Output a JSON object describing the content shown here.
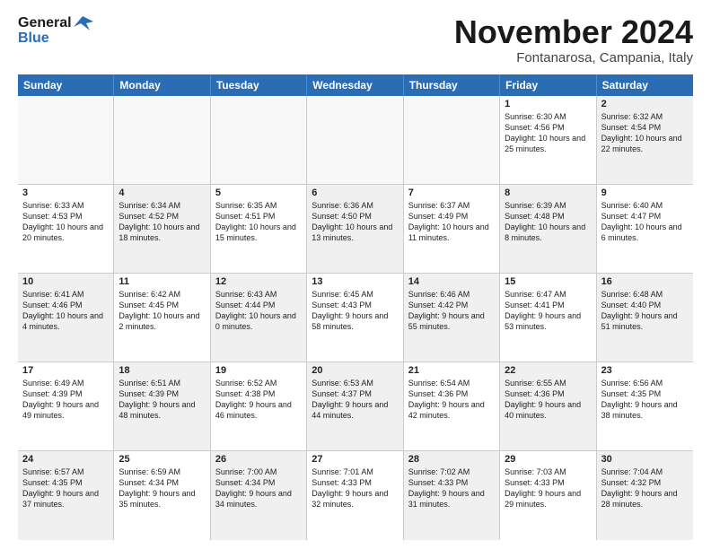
{
  "logo": {
    "line1": "General",
    "line2": "Blue"
  },
  "title": "November 2024",
  "location": "Fontanarosa, Campania, Italy",
  "header_days": [
    "Sunday",
    "Monday",
    "Tuesday",
    "Wednesday",
    "Thursday",
    "Friday",
    "Saturday"
  ],
  "weeks": [
    [
      {
        "day": "",
        "info": "",
        "shaded": true
      },
      {
        "day": "",
        "info": "",
        "shaded": true
      },
      {
        "day": "",
        "info": "",
        "shaded": true
      },
      {
        "day": "",
        "info": "",
        "shaded": true
      },
      {
        "day": "",
        "info": "",
        "shaded": true
      },
      {
        "day": "1",
        "info": "Sunrise: 6:30 AM\nSunset: 4:56 PM\nDaylight: 10 hours and 25 minutes.",
        "shaded": false
      },
      {
        "day": "2",
        "info": "Sunrise: 6:32 AM\nSunset: 4:54 PM\nDaylight: 10 hours and 22 minutes.",
        "shaded": true
      }
    ],
    [
      {
        "day": "3",
        "info": "Sunrise: 6:33 AM\nSunset: 4:53 PM\nDaylight: 10 hours and 20 minutes.",
        "shaded": false
      },
      {
        "day": "4",
        "info": "Sunrise: 6:34 AM\nSunset: 4:52 PM\nDaylight: 10 hours and 18 minutes.",
        "shaded": true
      },
      {
        "day": "5",
        "info": "Sunrise: 6:35 AM\nSunset: 4:51 PM\nDaylight: 10 hours and 15 minutes.",
        "shaded": false
      },
      {
        "day": "6",
        "info": "Sunrise: 6:36 AM\nSunset: 4:50 PM\nDaylight: 10 hours and 13 minutes.",
        "shaded": true
      },
      {
        "day": "7",
        "info": "Sunrise: 6:37 AM\nSunset: 4:49 PM\nDaylight: 10 hours and 11 minutes.",
        "shaded": false
      },
      {
        "day": "8",
        "info": "Sunrise: 6:39 AM\nSunset: 4:48 PM\nDaylight: 10 hours and 8 minutes.",
        "shaded": true
      },
      {
        "day": "9",
        "info": "Sunrise: 6:40 AM\nSunset: 4:47 PM\nDaylight: 10 hours and 6 minutes.",
        "shaded": false
      }
    ],
    [
      {
        "day": "10",
        "info": "Sunrise: 6:41 AM\nSunset: 4:46 PM\nDaylight: 10 hours and 4 minutes.",
        "shaded": true
      },
      {
        "day": "11",
        "info": "Sunrise: 6:42 AM\nSunset: 4:45 PM\nDaylight: 10 hours and 2 minutes.",
        "shaded": false
      },
      {
        "day": "12",
        "info": "Sunrise: 6:43 AM\nSunset: 4:44 PM\nDaylight: 10 hours and 0 minutes.",
        "shaded": true
      },
      {
        "day": "13",
        "info": "Sunrise: 6:45 AM\nSunset: 4:43 PM\nDaylight: 9 hours and 58 minutes.",
        "shaded": false
      },
      {
        "day": "14",
        "info": "Sunrise: 6:46 AM\nSunset: 4:42 PM\nDaylight: 9 hours and 55 minutes.",
        "shaded": true
      },
      {
        "day": "15",
        "info": "Sunrise: 6:47 AM\nSunset: 4:41 PM\nDaylight: 9 hours and 53 minutes.",
        "shaded": false
      },
      {
        "day": "16",
        "info": "Sunrise: 6:48 AM\nSunset: 4:40 PM\nDaylight: 9 hours and 51 minutes.",
        "shaded": true
      }
    ],
    [
      {
        "day": "17",
        "info": "Sunrise: 6:49 AM\nSunset: 4:39 PM\nDaylight: 9 hours and 49 minutes.",
        "shaded": false
      },
      {
        "day": "18",
        "info": "Sunrise: 6:51 AM\nSunset: 4:39 PM\nDaylight: 9 hours and 48 minutes.",
        "shaded": true
      },
      {
        "day": "19",
        "info": "Sunrise: 6:52 AM\nSunset: 4:38 PM\nDaylight: 9 hours and 46 minutes.",
        "shaded": false
      },
      {
        "day": "20",
        "info": "Sunrise: 6:53 AM\nSunset: 4:37 PM\nDaylight: 9 hours and 44 minutes.",
        "shaded": true
      },
      {
        "day": "21",
        "info": "Sunrise: 6:54 AM\nSunset: 4:36 PM\nDaylight: 9 hours and 42 minutes.",
        "shaded": false
      },
      {
        "day": "22",
        "info": "Sunrise: 6:55 AM\nSunset: 4:36 PM\nDaylight: 9 hours and 40 minutes.",
        "shaded": true
      },
      {
        "day": "23",
        "info": "Sunrise: 6:56 AM\nSunset: 4:35 PM\nDaylight: 9 hours and 38 minutes.",
        "shaded": false
      }
    ],
    [
      {
        "day": "24",
        "info": "Sunrise: 6:57 AM\nSunset: 4:35 PM\nDaylight: 9 hours and 37 minutes.",
        "shaded": true
      },
      {
        "day": "25",
        "info": "Sunrise: 6:59 AM\nSunset: 4:34 PM\nDaylight: 9 hours and 35 minutes.",
        "shaded": false
      },
      {
        "day": "26",
        "info": "Sunrise: 7:00 AM\nSunset: 4:34 PM\nDaylight: 9 hours and 34 minutes.",
        "shaded": true
      },
      {
        "day": "27",
        "info": "Sunrise: 7:01 AM\nSunset: 4:33 PM\nDaylight: 9 hours and 32 minutes.",
        "shaded": false
      },
      {
        "day": "28",
        "info": "Sunrise: 7:02 AM\nSunset: 4:33 PM\nDaylight: 9 hours and 31 minutes.",
        "shaded": true
      },
      {
        "day": "29",
        "info": "Sunrise: 7:03 AM\nSunset: 4:33 PM\nDaylight: 9 hours and 29 minutes.",
        "shaded": false
      },
      {
        "day": "30",
        "info": "Sunrise: 7:04 AM\nSunset: 4:32 PM\nDaylight: 9 hours and 28 minutes.",
        "shaded": true
      }
    ]
  ]
}
